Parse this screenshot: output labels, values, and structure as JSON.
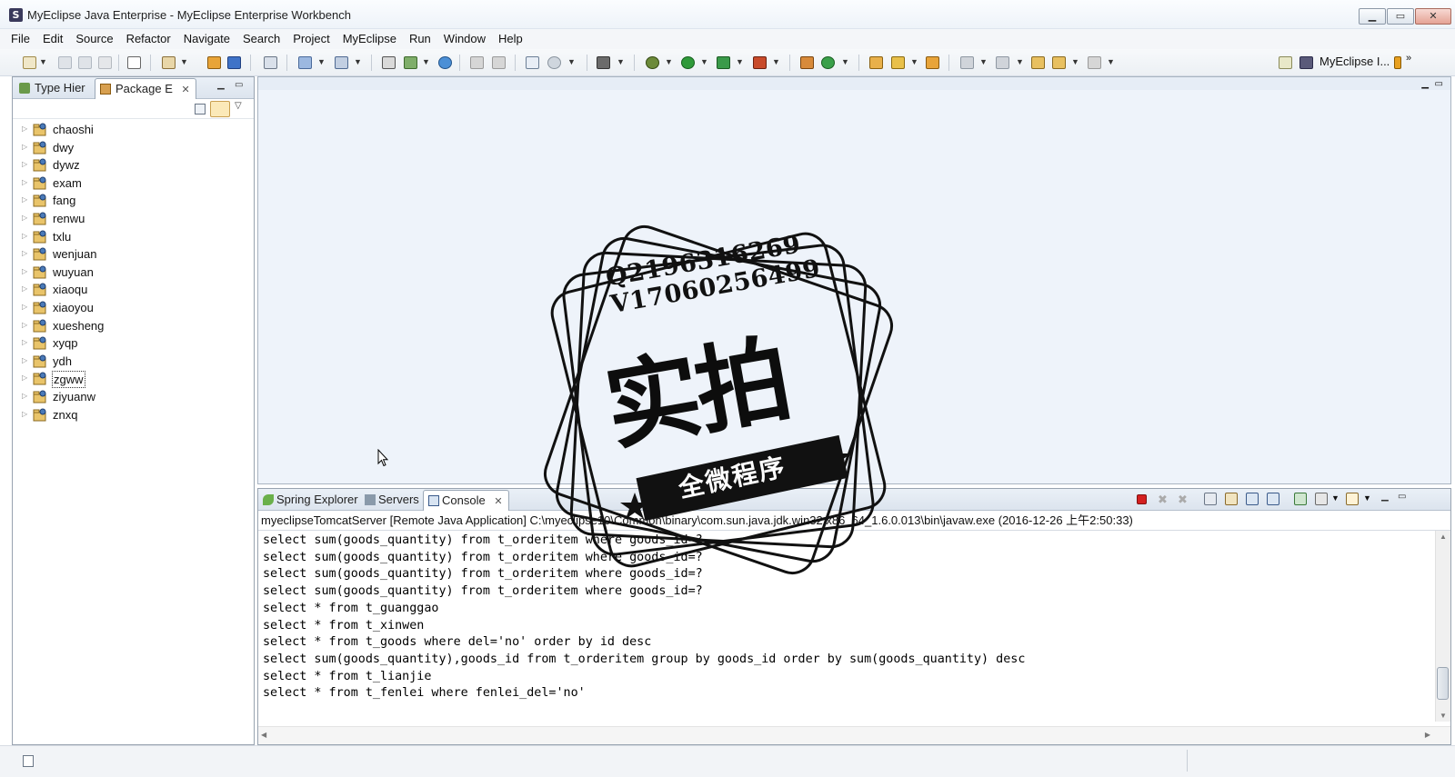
{
  "window": {
    "title": "MyEclipse Java Enterprise - MyEclipse Enterprise Workbench",
    "app_icon_glyph": "S",
    "minimize_glyph": "▁",
    "maximize_glyph": "▭",
    "close_glyph": "✕"
  },
  "menu": [
    "File",
    "Edit",
    "Source",
    "Refactor",
    "Navigate",
    "Search",
    "Project",
    "MyEclipse",
    "Run",
    "Window",
    "Help"
  ],
  "toolbar": {
    "perspective_label": "MyEclipse I...",
    "chevron": "»"
  },
  "left_view": {
    "tabs": [
      {
        "label": "Type Hier",
        "icon": "type-hierarchy-icon"
      },
      {
        "label": "Package E",
        "icon": "package-explorer-icon",
        "close": "✕"
      }
    ],
    "projects": [
      "chaoshi",
      "dwy",
      "dywz",
      "exam",
      "fang",
      "renwu",
      "txlu",
      "wenjuan",
      "wuyuan",
      "xiaoqu",
      "xiaoyou",
      "xuesheng",
      "xyqp",
      "ydh",
      "zgww",
      "ziyuanw",
      "znxq"
    ],
    "selected_project": "zgww"
  },
  "bottom_view": {
    "tabs": [
      {
        "label": "Spring Explorer",
        "icon": "spring-leaf-icon"
      },
      {
        "label": "Servers",
        "icon": "servers-icon"
      },
      {
        "label": "Console",
        "icon": "console-icon",
        "close": "✕"
      }
    ],
    "console_description": "myeclipseTomcatServer [Remote Java Application] C:\\myeclipse10\\Common\\binary\\com.sun.java.jdk.win32.x86_64_1.6.0.013\\bin\\javaw.exe (2016-12-26 上午2:50:33)",
    "console_lines": [
      "select sum(goods_quantity) from t_orderitem where goods_id=?",
      "select sum(goods_quantity) from t_orderitem where goods_id=?",
      "select sum(goods_quantity) from t_orderitem where goods_id=?",
      "select sum(goods_quantity) from t_orderitem where goods_id=?",
      "select * from t_guanggao",
      "select * from t_xinwen",
      "select * from t_goods where del='no' order by id desc",
      "select sum(goods_quantity),goods_id from t_orderitem group by goods_id order by sum(goods_quantity) desc",
      "select * from t_lianjie",
      "select * from t_fenlei where fenlei_del='no'"
    ]
  },
  "watermark": {
    "line1": "Q2196316269",
    "line2": "V17060256499",
    "big_text": "实拍",
    "ribbon_text": "全微程序"
  },
  "colors": {
    "terminate_red": "#d42020",
    "toolbar_bg": "#eef2f6",
    "selection_border": "#333333"
  }
}
